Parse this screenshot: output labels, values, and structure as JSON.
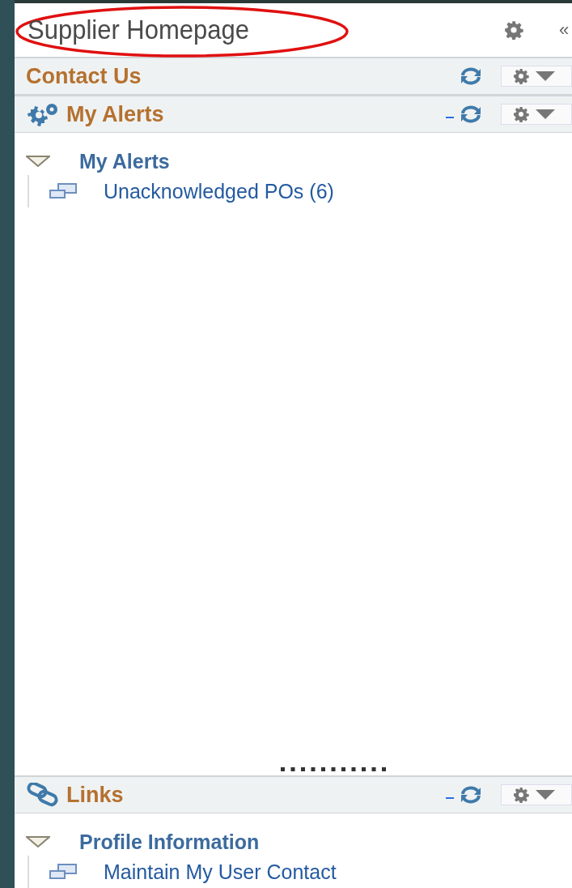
{
  "title": "Supplier Homepage",
  "title_highlighted": true,
  "collapse_icon": "«",
  "panels": [
    {
      "title": "Contact Us",
      "kind": "plain",
      "expanded": false
    },
    {
      "title": "My Alerts",
      "kind": "alerts",
      "expanded": true,
      "resizable": true,
      "groups": [
        {
          "label": "My Alerts",
          "expanded": true,
          "children": [
            {
              "label": "Unacknowledged POs (6)"
            }
          ]
        }
      ]
    },
    {
      "title": "Links",
      "kind": "links",
      "expanded": true,
      "resizable": false,
      "groups": [
        {
          "label": "Profile Information",
          "expanded": true,
          "children": [
            {
              "label": "Maintain My User Contact"
            }
          ]
        }
      ]
    }
  ]
}
